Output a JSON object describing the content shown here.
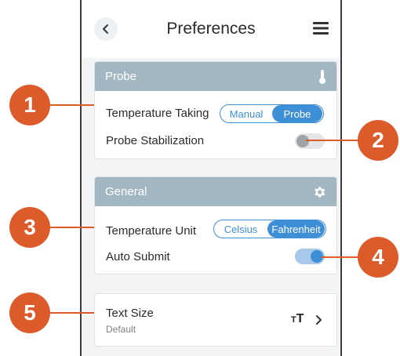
{
  "header": {
    "title": "Preferences"
  },
  "probe": {
    "section_title": "Probe",
    "temperature_taking": {
      "label": "Temperature Taking",
      "options": [
        "Manual",
        "Probe"
      ],
      "selected": "Probe"
    },
    "probe_stabilization": {
      "label": "Probe Stabilization",
      "enabled": false
    }
  },
  "general": {
    "section_title": "General",
    "temperature_unit": {
      "label": "Temperature Unit",
      "options": [
        "Celsius",
        "Fahrenheit"
      ],
      "selected": "Fahrenheit"
    },
    "auto_submit": {
      "label": "Auto Submit",
      "enabled": true
    }
  },
  "text_size": {
    "label": "Text Size",
    "value": "Default"
  },
  "callouts": [
    "1",
    "2",
    "3",
    "4",
    "5"
  ],
  "icons": {
    "back": "chevron-left-icon",
    "menu": "menu-icon",
    "probe_header": "thermometer-icon",
    "general_header": "gear-icon",
    "text_size": "text-size-icon",
    "text_size_nav": "chevron-right-icon"
  },
  "colors": {
    "accent": "#3f8fd6",
    "section_header": "#a3b7c3",
    "callout": "#dd5a2a"
  }
}
